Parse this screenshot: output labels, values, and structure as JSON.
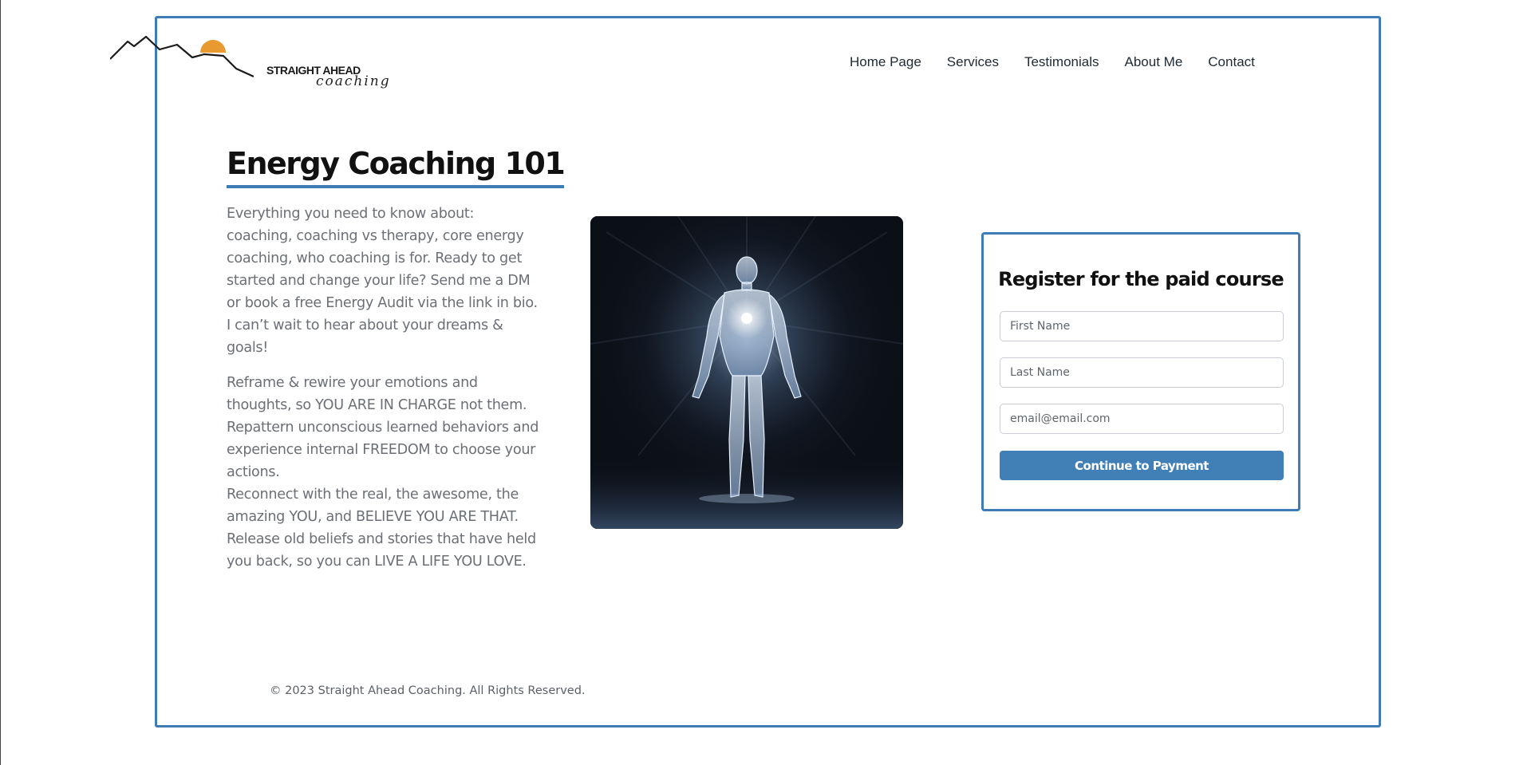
{
  "logo": {
    "text": "STRAIGHT AHEAD",
    "script": "coaching",
    "sun_color": "#e8992f"
  },
  "nav": {
    "items": [
      "Home Page",
      "Services",
      "Testimonials",
      "About Me",
      "Contact"
    ]
  },
  "main": {
    "title": "Energy Coaching 101",
    "paragraph_1": "Everything you need to know about: coaching, coaching vs therapy, core energy coaching, who coaching is for. Ready to get started and change your life? Send me a DM or book a free Energy Audit via the link in bio. I can’t wait to hear about your dreams & goals!",
    "paragraph_2": "Reframe & rewire your emotions and thoughts, so YOU ARE IN CHARGE not them. Repattern unconscious learned behaviors and experience internal FREEDOM to choose your actions.",
    "paragraph_3": "Reconnect with the real, the awesome, the amazing YOU, and BELIEVE YOU ARE THAT. Release old beliefs and stories that have held you back, so you can LIVE A LIFE YOU LOVE."
  },
  "register": {
    "heading": "Register for the paid course",
    "first_name_placeholder": "First Name",
    "last_name_placeholder": "Last Name",
    "email_placeholder": "email@email.com",
    "submit_label": "Continue to Payment"
  },
  "footer": {
    "copyright": "© 2023 Straight Ahead Coaching. All Rights Reserved."
  },
  "colors": {
    "accent": "#3f7bb5",
    "button": "#4180b7"
  }
}
